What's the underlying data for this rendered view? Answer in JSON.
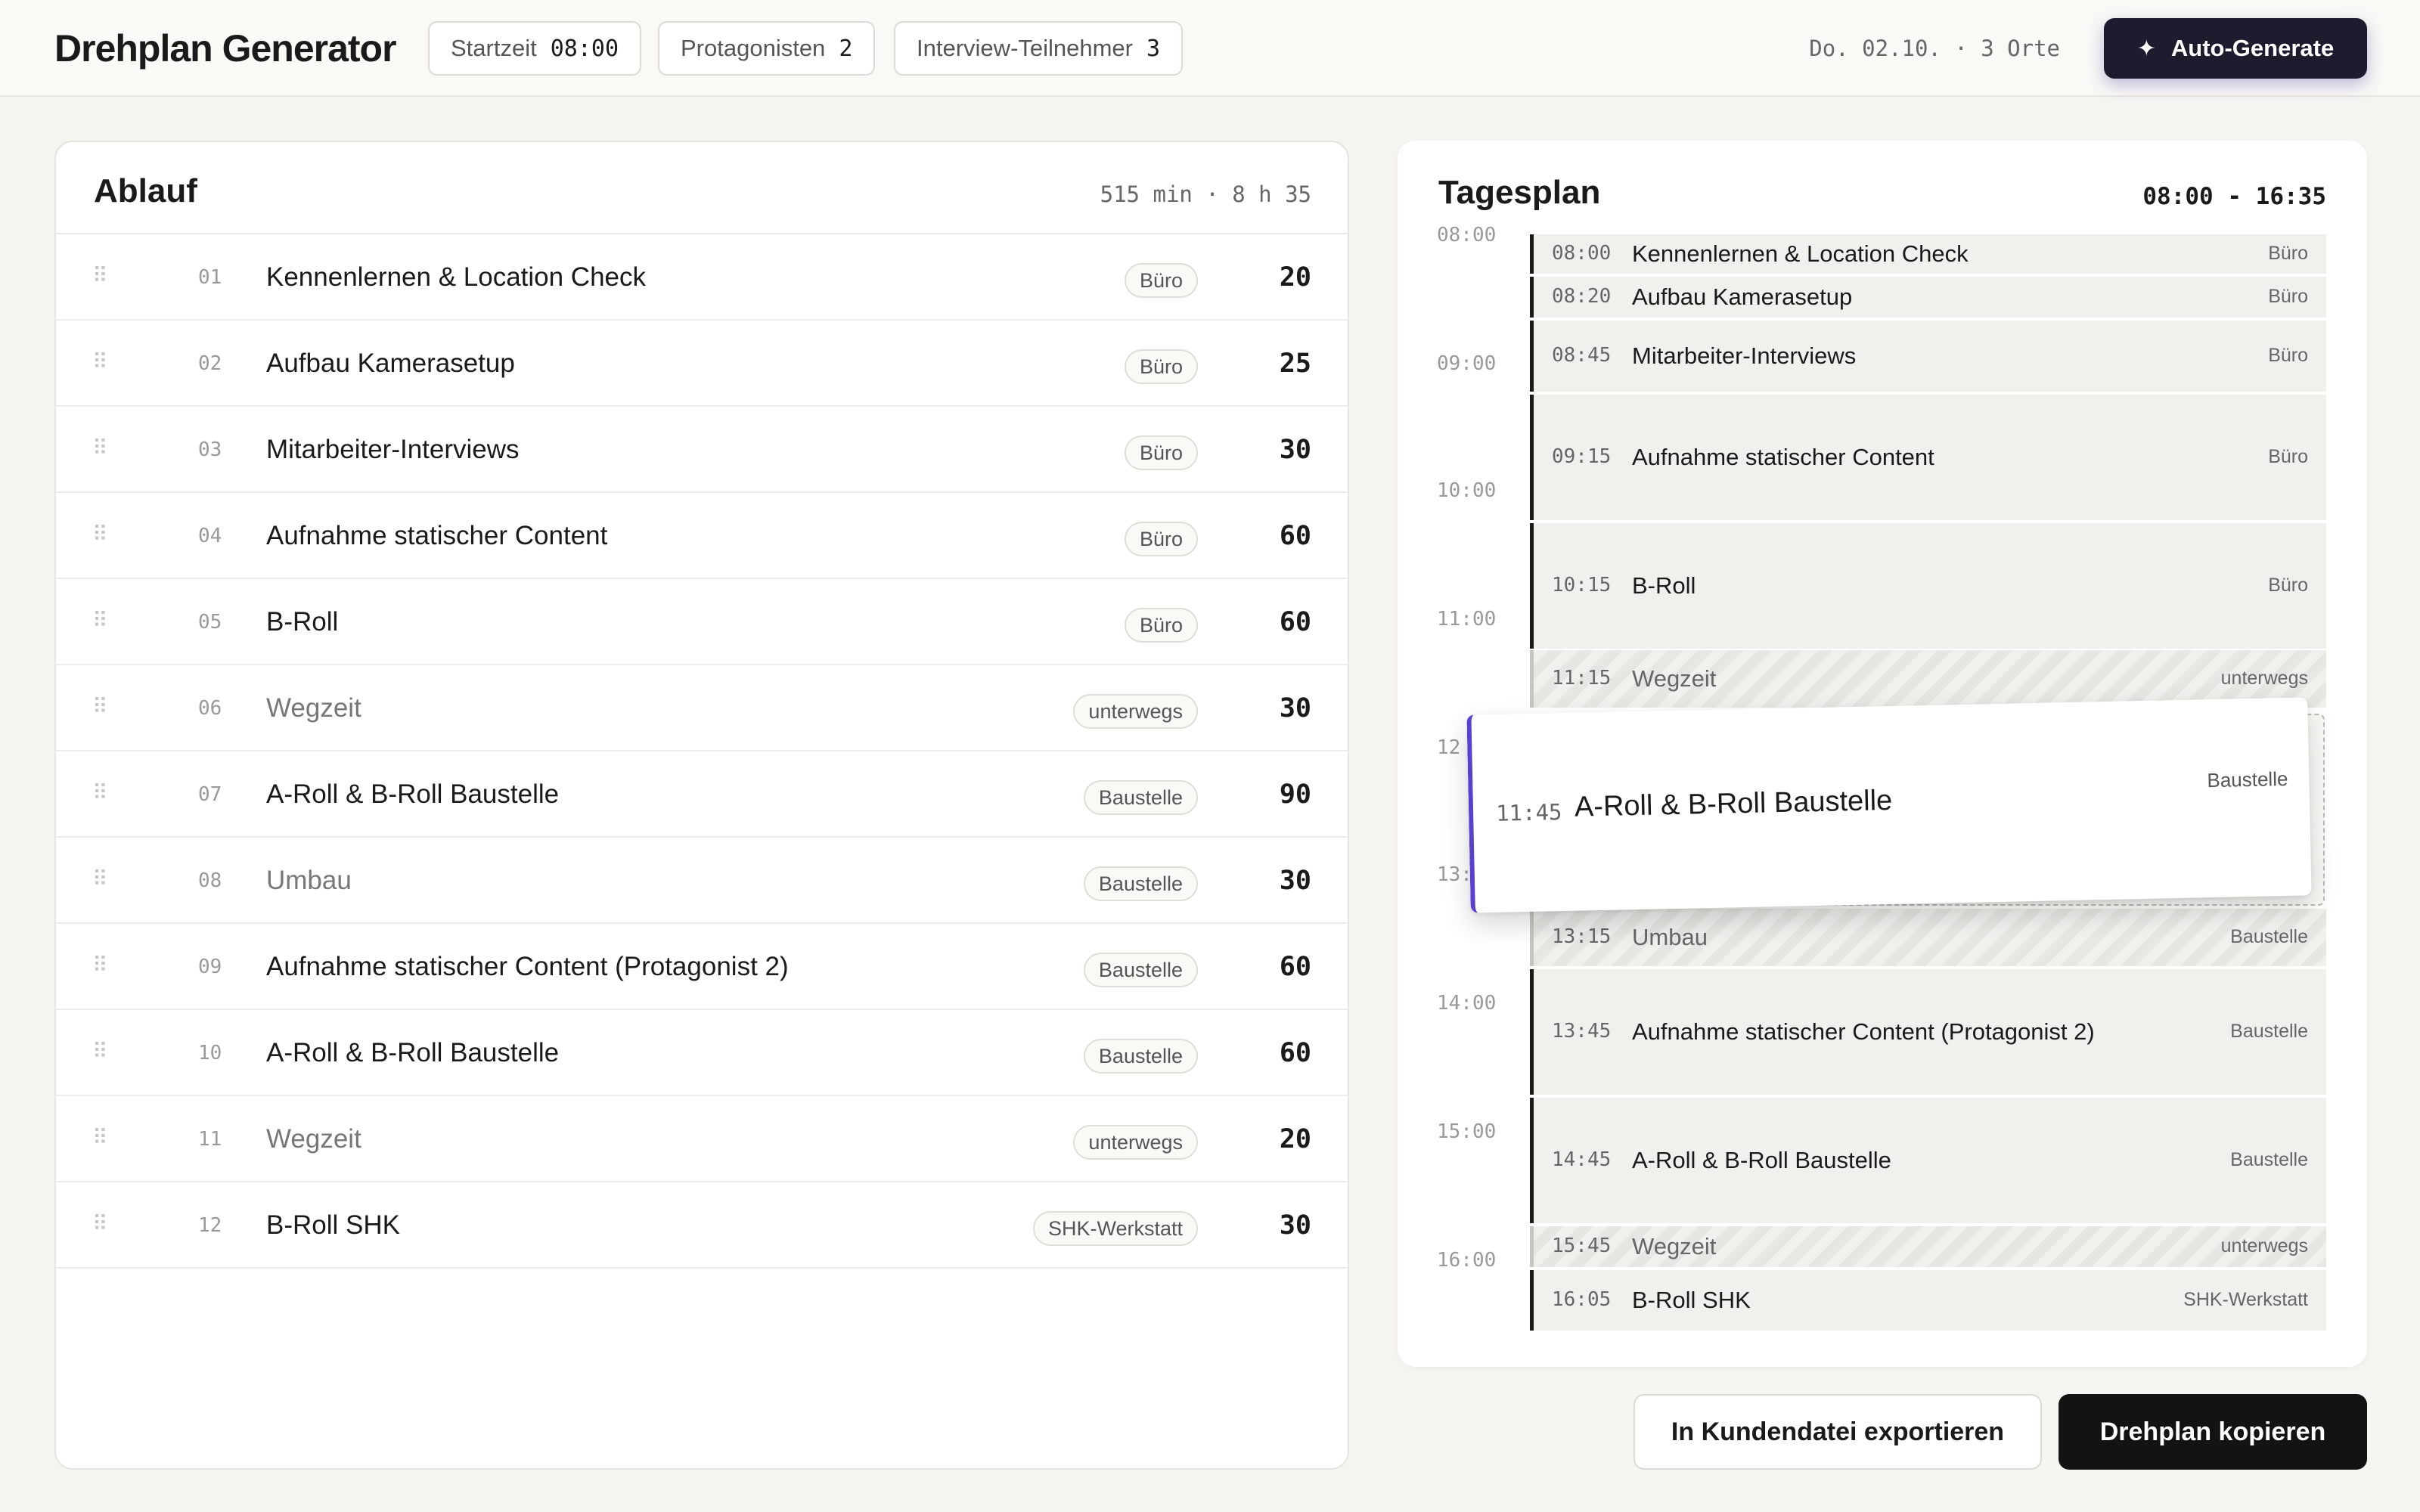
{
  "header": {
    "title": "Drehplan Generator",
    "chips": [
      {
        "label": "Startzeit",
        "value": "08:00"
      },
      {
        "label": "Protagonisten",
        "value": "2"
      },
      {
        "label": "Interview-Teilnehmer",
        "value": "3"
      }
    ],
    "meta": "Do. 02.10. · 3 Orte",
    "auto_generate_label": "Auto-Generate"
  },
  "ablauf": {
    "title": "Ablauf",
    "summary": "515 min · 8 h 35",
    "rows": [
      {
        "num": "01",
        "name": "Kennenlernen & Location Check",
        "tag": "Büro",
        "duration": "20"
      },
      {
        "num": "02",
        "name": "Aufbau Kamerasetup",
        "tag": "Büro",
        "duration": "25"
      },
      {
        "num": "03",
        "name": "Mitarbeiter-Interviews",
        "tag": "Büro",
        "duration": "30"
      },
      {
        "num": "04",
        "name": "Aufnahme statischer Content",
        "tag": "Büro",
        "duration": "60"
      },
      {
        "num": "05",
        "name": "B-Roll",
        "tag": "Büro",
        "duration": "60"
      },
      {
        "num": "06",
        "name": "Wegzeit",
        "tag": "unterwegs",
        "duration": "30"
      },
      {
        "num": "07",
        "name": "A-Roll & B-Roll Baustelle",
        "tag": "Baustelle",
        "duration": "90"
      },
      {
        "num": "08",
        "name": "Umbau",
        "tag": "Baustelle",
        "duration": "30"
      },
      {
        "num": "09",
        "name": "Aufnahme statischer Content (Protagonist 2)",
        "tag": "Baustelle",
        "duration": "60"
      },
      {
        "num": "10",
        "name": "A-Roll & B-Roll Baustelle",
        "tag": "Baustelle",
        "duration": "60"
      },
      {
        "num": "11",
        "name": "Wegzeit",
        "tag": "unterwegs",
        "duration": "20"
      },
      {
        "num": "12",
        "name": "B-Roll SHK",
        "tag": "SHK-Werkstatt",
        "duration": "30"
      }
    ]
  },
  "tagesplan": {
    "title": "Tagesplan",
    "range": "08:00 - 16:35",
    "hours": [
      "08:00",
      "09:00",
      "10:00",
      "11:00",
      "12",
      "13:",
      "14:00",
      "15:00",
      "16:00"
    ],
    "blocks": [
      {
        "time": "08:00",
        "name": "Kennenlernen & Location Check",
        "loc": "Büro"
      },
      {
        "time": "08:20",
        "name": "Aufbau Kamerasetup",
        "loc": "Büro"
      },
      {
        "time": "08:45",
        "name": "Mitarbeiter-Interviews",
        "loc": "Büro"
      },
      {
        "time": "09:15",
        "name": "Aufnahme statischer Content",
        "loc": "Büro"
      },
      {
        "time": "10:15",
        "name": "B-Roll",
        "loc": "Büro"
      },
      {
        "time": "11:15",
        "name": "Wegzeit",
        "loc": "unterwegs"
      },
      {
        "time": "13:15",
        "name": "Umbau",
        "loc": "Baustelle"
      },
      {
        "time": "13:45",
        "name": "Aufnahme statischer Content (Protagonist 2)",
        "loc": "Baustelle"
      },
      {
        "time": "14:45",
        "name": "A-Roll & B-Roll Baustelle",
        "loc": "Baustelle"
      },
      {
        "time": "15:45",
        "name": "Wegzeit",
        "loc": "unterwegs"
      },
      {
        "time": "16:05",
        "name": "B-Roll SHK",
        "loc": "SHK-Werkstatt"
      }
    ],
    "dragging": {
      "time": "11:45",
      "name": "A-Roll & B-Roll Baustelle",
      "loc": "Baustelle"
    }
  },
  "actions": {
    "export_label": "In Kundendatei exportieren",
    "copy_label": "Drehplan kopieren"
  },
  "colors": {
    "accent": "#5b3fd0",
    "dark_button": "#131313",
    "auto_button": "#1e1b2e"
  }
}
